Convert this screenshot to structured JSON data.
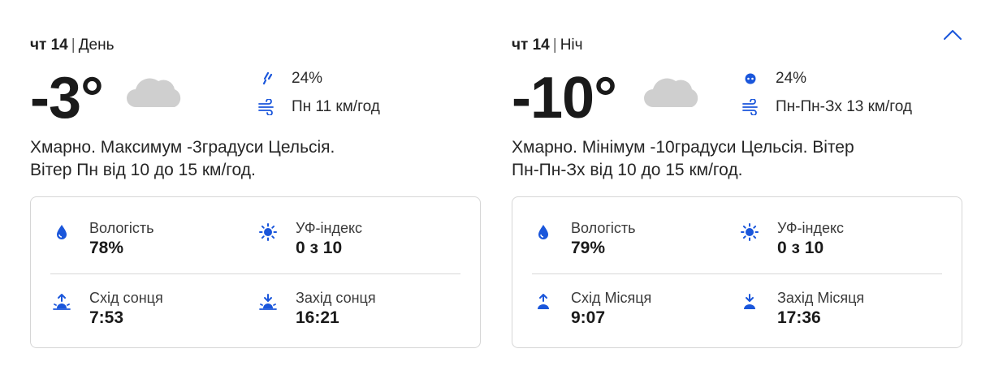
{
  "colors": {
    "accent": "#1a56db",
    "cloud": "#cfcfcf",
    "text": "#1f1f1f"
  },
  "day": {
    "date": "чт 14",
    "period": "День",
    "temperature": "-3°",
    "condition_icon": "cloud-icon",
    "precipitation": "24%",
    "wind": "Пн 11 км/год",
    "summary_line1": "Хмарно. Максимум -3градуси Цельсія.",
    "summary_line2": "Вітер Пн від 10 до 15 км/год.",
    "stats": {
      "humidity_label": "Вологість",
      "humidity_value": "78%",
      "uv_label": "УФ-індекс",
      "uv_value": "0 з 10",
      "sunrise_label": "Схід сонця",
      "sunrise_value": "7:53",
      "sunset_label": "Захід сонця",
      "sunset_value": "16:21"
    }
  },
  "night": {
    "date": "чт 14",
    "period": "Ніч",
    "temperature": "-10°",
    "condition_icon": "cloud-icon",
    "precipitation": "24%",
    "wind": "Пн-Пн-Зх 13 км/год",
    "summary_line1": "Хмарно. Мінімум -10градуси Цельсія. Вітер",
    "summary_line2": "Пн-Пн-Зх від 10 до 15 км/год.",
    "stats": {
      "humidity_label": "Вологість",
      "humidity_value": "79%",
      "uv_label": "УФ-індекс",
      "uv_value": "0 з 10",
      "moonrise_label": "Схід Місяця",
      "moonrise_value": "9:07",
      "moonset_label": "Захід Місяця",
      "moonset_value": "17:36"
    }
  },
  "collapse_icon": "chevron-up-icon"
}
